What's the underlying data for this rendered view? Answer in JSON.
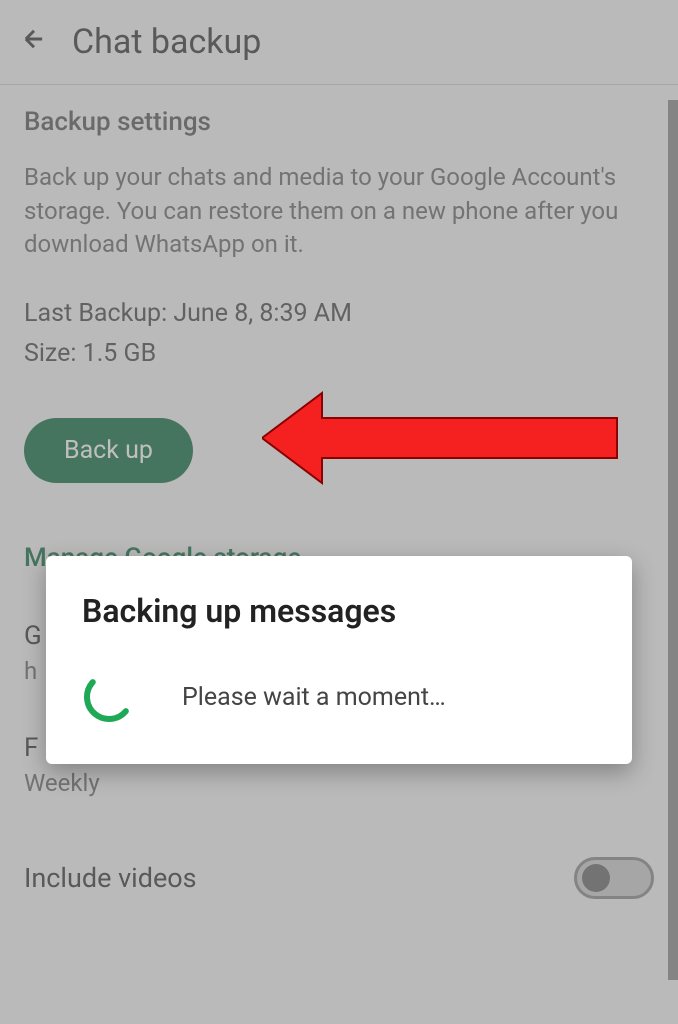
{
  "header": {
    "title": "Chat backup"
  },
  "section": {
    "title": "Backup settings",
    "description": "Back up your chats and media to your Google Account's storage. You can restore them on a new phone after you download WhatsApp on it.",
    "last_backup_label": "Last Backup:",
    "last_backup_value": "June 8, 8:39 AM",
    "size_label": "Size:",
    "size_value": "1.5 GB"
  },
  "buttons": {
    "backup": "Back up"
  },
  "links": {
    "manage_storage": "Manage Google storage"
  },
  "settings": {
    "google_account_label": "G",
    "google_account_value": "h",
    "frequency_label": "F",
    "frequency_value": "Weekly",
    "include_videos_label": "Include videos"
  },
  "dialog": {
    "title": "Backing up messages",
    "message": "Please wait a moment…"
  },
  "colors": {
    "accent": "#0c6b3e",
    "arrow": "#f52020"
  }
}
